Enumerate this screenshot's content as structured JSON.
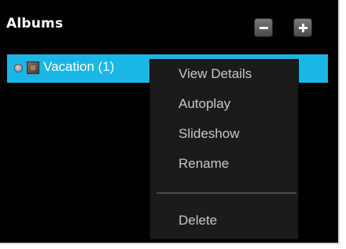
{
  "header": {
    "title": "Albums",
    "remove_icon": "minus-icon",
    "add_icon": "plus-icon"
  },
  "albums": {
    "items": [
      {
        "label": "Vacation (1)",
        "selected": true,
        "selected_color": "#19b6e6"
      }
    ]
  },
  "context_menu": {
    "items": [
      {
        "label": "View Details"
      },
      {
        "label": "Autoplay"
      },
      {
        "label": "Slideshow"
      },
      {
        "label": "Rename"
      },
      {
        "label": "Delete"
      }
    ]
  }
}
